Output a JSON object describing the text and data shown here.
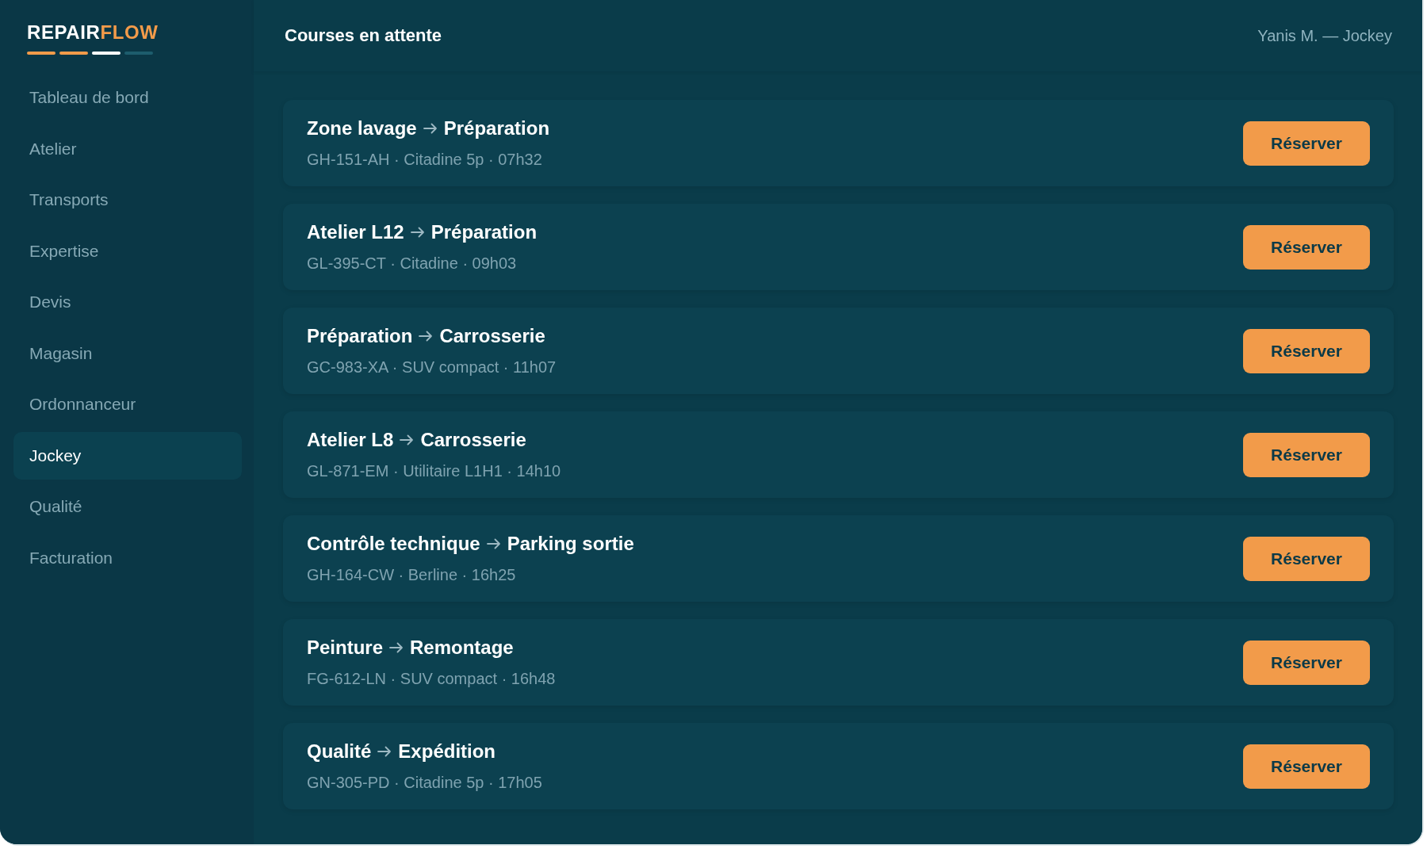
{
  "logo": {
    "primary": "REPAIR",
    "accent": "FLOW"
  },
  "sidebar": {
    "items": [
      {
        "label": "Tableau de bord",
        "selected": false
      },
      {
        "label": "Atelier",
        "selected": false
      },
      {
        "label": "Transports",
        "selected": false
      },
      {
        "label": "Expertise",
        "selected": false
      },
      {
        "label": "Devis",
        "selected": false
      },
      {
        "label": "Magasin",
        "selected": false
      },
      {
        "label": "Ordonnanceur",
        "selected": false
      },
      {
        "label": "Jockey",
        "selected": true
      },
      {
        "label": "Qualité",
        "selected": false
      },
      {
        "label": "Facturation",
        "selected": false
      }
    ]
  },
  "header": {
    "title": "Courses en attente",
    "user": "Yanis M. — Jockey"
  },
  "courses": [
    {
      "from": "Zone lavage",
      "to": "Préparation",
      "details": "GH-151-AH · Citadine 5p · 07h32",
      "action": "Réserver"
    },
    {
      "from": "Atelier L12",
      "to": "Préparation",
      "details": "GL-395-CT · Citadine · 09h03",
      "action": "Réserver"
    },
    {
      "from": "Préparation",
      "to": "Carrosserie",
      "details": "GC-983-XA · SUV compact · 11h07",
      "action": "Réserver"
    },
    {
      "from": "Atelier L8",
      "to": "Carrosserie",
      "details": "GL-871-EM · Utilitaire L1H1 · 14h10",
      "action": "Réserver"
    },
    {
      "from": "Contrôle technique",
      "to": "Parking sortie",
      "details": "GH-164-CW · Berline · 16h25",
      "action": "Réserver"
    },
    {
      "from": "Peinture",
      "to": "Remontage",
      "details": "FG-612-LN · SUV compact · 16h48",
      "action": "Réserver"
    },
    {
      "from": "Qualité",
      "to": "Expédition",
      "details": "GN-305-PD · Citadine 5p · 17h05",
      "action": "Réserver"
    }
  ]
}
